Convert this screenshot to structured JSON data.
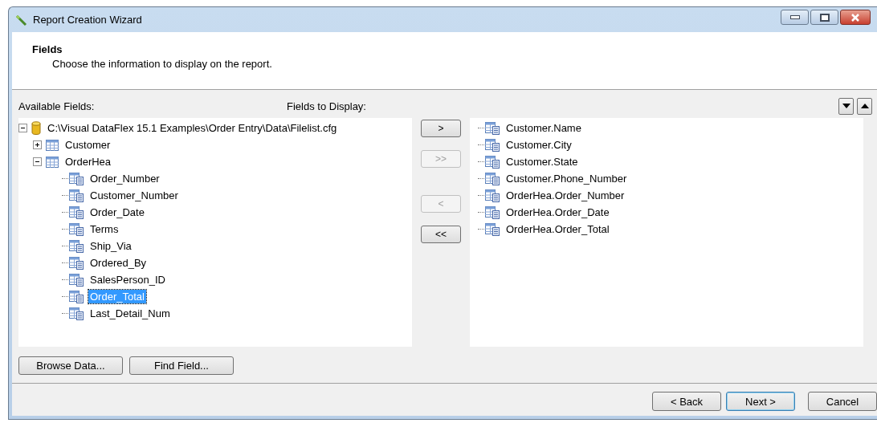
{
  "window": {
    "title": "Report Creation Wizard"
  },
  "header": {
    "title": "Fields",
    "subtitle": "Choose the information to display on the report."
  },
  "available_label": "Available Fields:",
  "display_label": "Fields to Display:",
  "available_tree": [
    {
      "label": "C:\\Visual DataFlex 15.1 Examples\\Order Entry\\Data\\Filelist.cfg",
      "kind": "database",
      "expanded": true,
      "selected": false,
      "children": [
        {
          "label": "Customer",
          "kind": "table",
          "expanded": false,
          "selected": false
        },
        {
          "label": "OrderHea",
          "kind": "table",
          "expanded": true,
          "selected": false,
          "children": [
            {
              "label": "Order_Number",
              "kind": "field",
              "selected": false
            },
            {
              "label": "Customer_Number",
              "kind": "field",
              "selected": false
            },
            {
              "label": "Order_Date",
              "kind": "field",
              "selected": false
            },
            {
              "label": "Terms",
              "kind": "field",
              "selected": false
            },
            {
              "label": "Ship_Via",
              "kind": "field",
              "selected": false
            },
            {
              "label": "Ordered_By",
              "kind": "field",
              "selected": false
            },
            {
              "label": "SalesPerson_ID",
              "kind": "field",
              "selected": false
            },
            {
              "label": "Order_Total",
              "kind": "field",
              "selected": true
            },
            {
              "label": "Last_Detail_Num",
              "kind": "field",
              "selected": false
            }
          ]
        }
      ]
    }
  ],
  "move_buttons": [
    {
      "label": ">",
      "disabled": false
    },
    {
      "label": ">>",
      "disabled": true
    },
    {
      "label": "<",
      "disabled": true
    },
    {
      "label": "<<",
      "disabled": false
    }
  ],
  "display_fields": [
    {
      "label": "Customer.Name",
      "selected": false
    },
    {
      "label": "Customer.City",
      "selected": false
    },
    {
      "label": "Customer.State",
      "selected": false
    },
    {
      "label": "Customer.Phone_Number",
      "selected": false
    },
    {
      "label": "OrderHea.Order_Number",
      "selected": false
    },
    {
      "label": "OrderHea.Order_Date",
      "selected": false
    },
    {
      "label": "OrderHea.Order_Total",
      "selected": false
    }
  ],
  "lower_buttons": [
    "Browse Data...",
    "Find Field..."
  ],
  "footer_buttons": [
    {
      "label": "< Back",
      "default": false
    },
    {
      "label": "Next >",
      "default": true
    },
    {
      "label": "Cancel",
      "default": false
    }
  ]
}
